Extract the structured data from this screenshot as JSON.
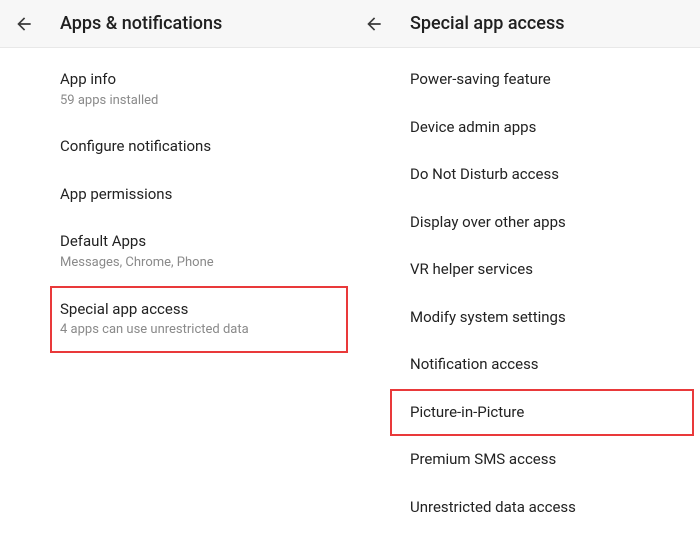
{
  "left": {
    "header": "Apps & notifications",
    "items": [
      {
        "title": "App info",
        "sub": "59 apps installed"
      },
      {
        "title": "Configure notifications",
        "sub": null
      },
      {
        "title": "App permissions",
        "sub": null
      },
      {
        "title": "Default Apps",
        "sub": "Messages, Chrome, Phone"
      },
      {
        "title": "Special app access",
        "sub": "4 apps can use unrestricted data",
        "highlight": true
      }
    ]
  },
  "right": {
    "header": "Special app access",
    "items": [
      {
        "title": "Power-saving feature"
      },
      {
        "title": "Device admin apps"
      },
      {
        "title": "Do Not Disturb access"
      },
      {
        "title": "Display over other apps"
      },
      {
        "title": "VR helper services"
      },
      {
        "title": "Modify system settings"
      },
      {
        "title": "Notification access"
      },
      {
        "title": "Picture-in-Picture",
        "highlight": true
      },
      {
        "title": "Premium SMS access"
      },
      {
        "title": "Unrestricted data access"
      }
    ]
  }
}
